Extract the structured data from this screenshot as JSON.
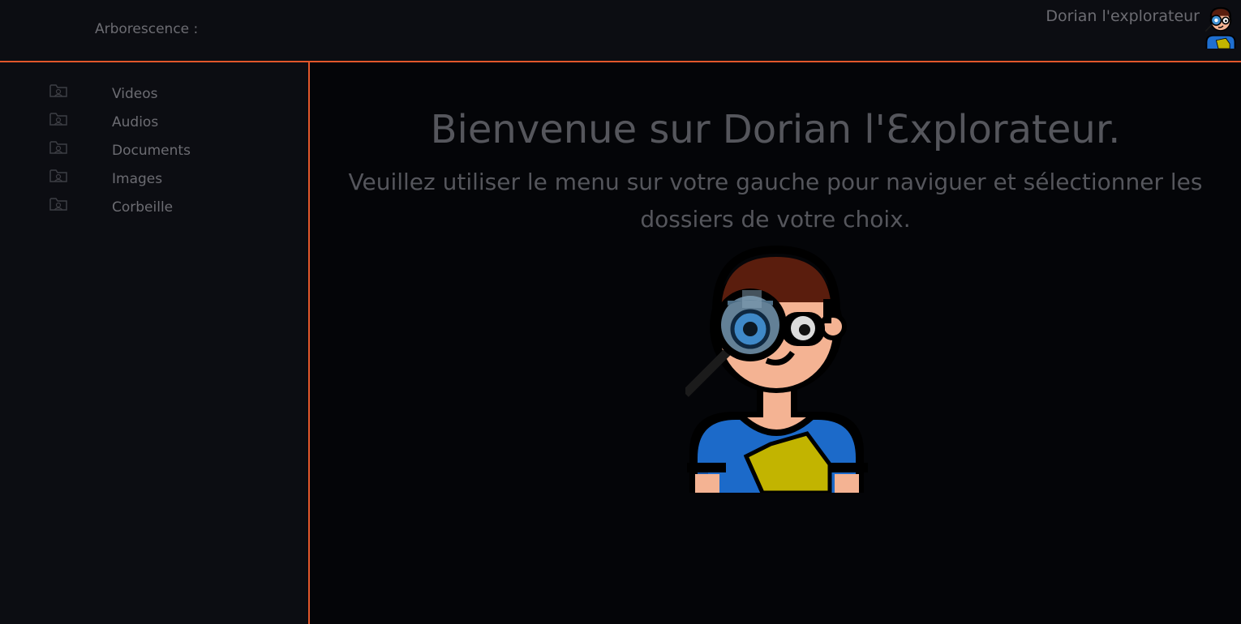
{
  "header": {
    "tree_title": "Arborescence :",
    "user_name": "Dorian l'explorateur",
    "avatar_icon": "explorer-avatar-icon"
  },
  "sidebar": {
    "items": [
      {
        "label": "Videos",
        "icon": "folder-icon"
      },
      {
        "label": "Audios",
        "icon": "folder-icon"
      },
      {
        "label": "Documents",
        "icon": "folder-icon"
      },
      {
        "label": "Images",
        "icon": "folder-icon"
      },
      {
        "label": "Corbeille",
        "icon": "folder-icon"
      }
    ]
  },
  "main": {
    "title": "Bienvenue sur Dorian l'Ɛxplorateur.",
    "text": "Veuillez utiliser le menu sur votre gauche pour naviguer et sélectionner les dossiers de votre choix.",
    "illustration": "explorer-illustration"
  },
  "colors": {
    "accent": "#e2572b",
    "header_bg": "#0c0d12",
    "main_bg": "#040508",
    "text": "#6c6c72"
  }
}
